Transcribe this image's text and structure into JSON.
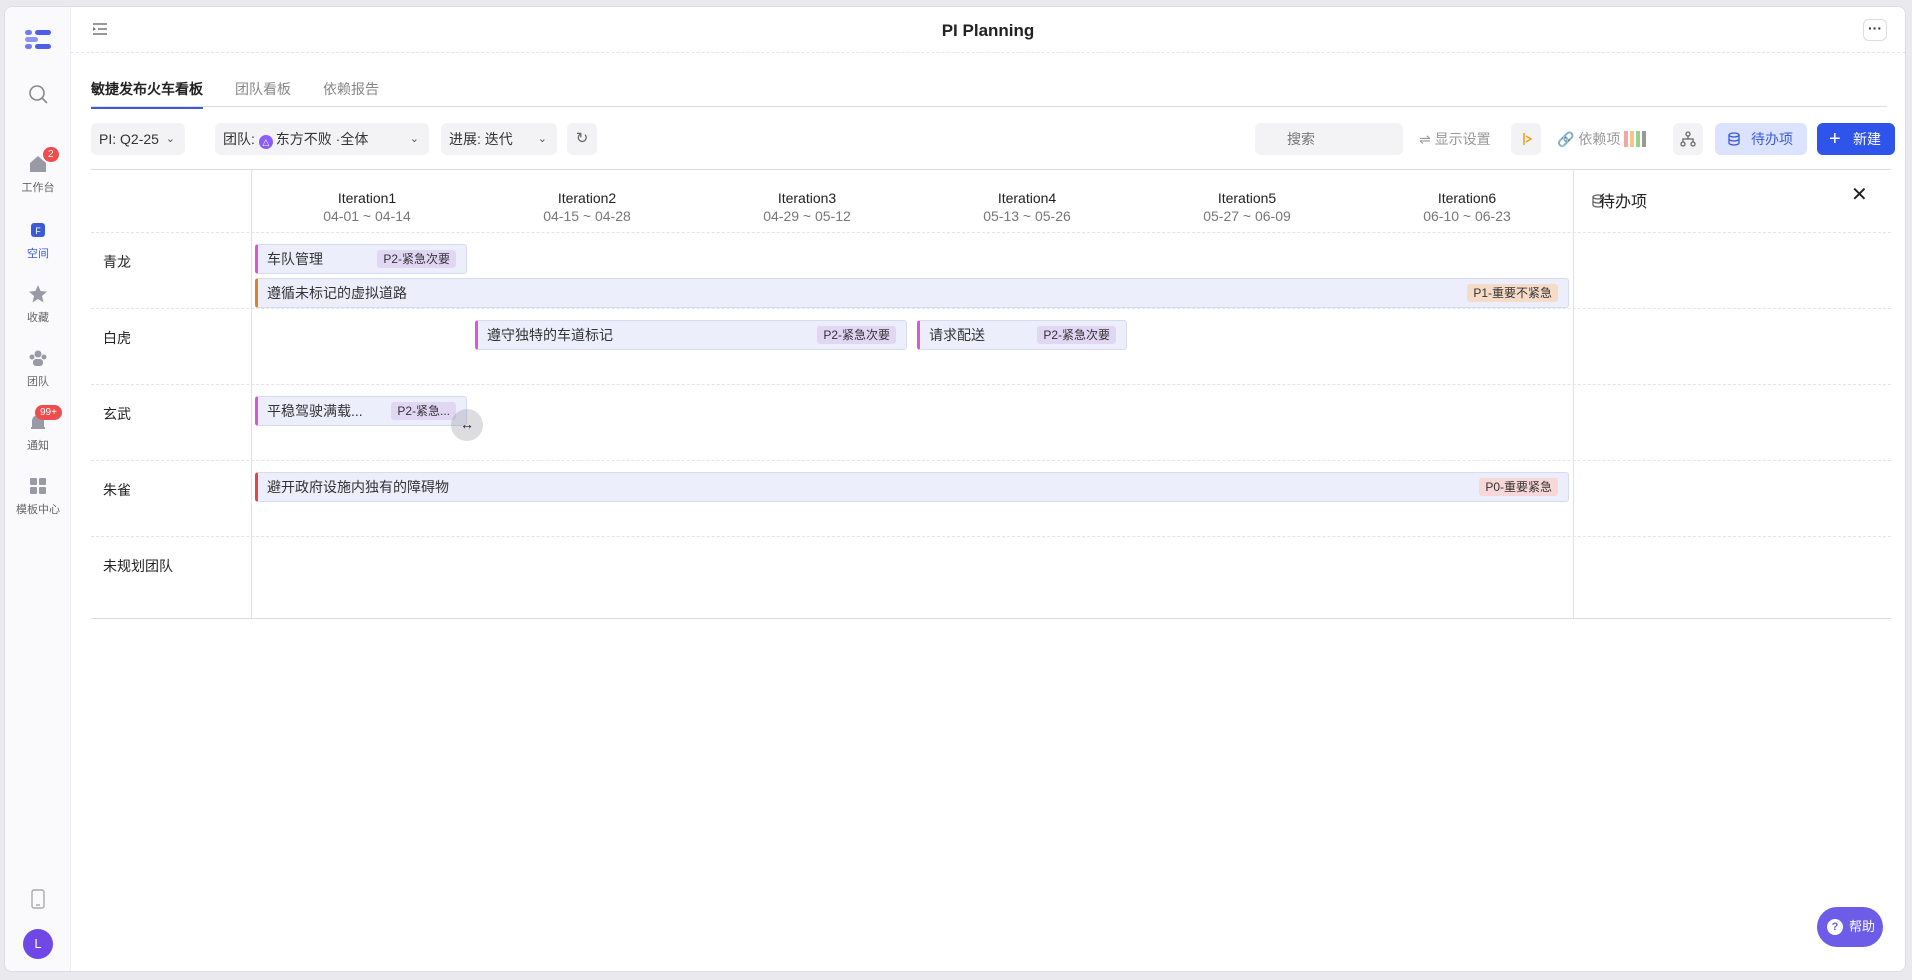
{
  "app": {
    "title": "PI Planning"
  },
  "sidebar": {
    "items": [
      {
        "label": "工作台",
        "icon": "home-icon",
        "badge": "2"
      },
      {
        "label": "空间",
        "icon": "space-icon",
        "active": true
      },
      {
        "label": "收藏",
        "icon": "star-icon"
      },
      {
        "label": "团队",
        "icon": "team-icon"
      },
      {
        "label": "通知",
        "icon": "bell-icon",
        "badge": "99+"
      },
      {
        "label": "模板中心",
        "icon": "template-icon"
      }
    ],
    "avatar": "L"
  },
  "tabs": [
    {
      "label": "敏捷发布火车看板",
      "active": true
    },
    {
      "label": "团队看板"
    },
    {
      "label": "依赖报告"
    }
  ],
  "toolbar": {
    "pi_label": "PI:",
    "pi_value": "Q2-25",
    "team_label": "团队:",
    "team_value": "东方不败 ·全体",
    "progress_label": "进展:",
    "progress_value": "迭代",
    "search_placeholder": "搜索",
    "display_settings": "显示设置",
    "dependency": "依赖项",
    "todo": "待办项",
    "new": "新建"
  },
  "iterations": [
    {
      "name": "Iteration1",
      "dates": "04-01 ~ 04-14"
    },
    {
      "name": "Iteration2",
      "dates": "04-15 ~ 04-28"
    },
    {
      "name": "Iteration3",
      "dates": "04-29 ~ 05-12"
    },
    {
      "name": "Iteration4",
      "dates": "05-13 ~ 05-26"
    },
    {
      "name": "Iteration5",
      "dates": "05-27 ~ 06-09"
    },
    {
      "name": "Iteration6",
      "dates": "06-10 ~ 06-23"
    }
  ],
  "teams": [
    {
      "name": "青龙"
    },
    {
      "name": "白虎"
    },
    {
      "name": "玄武"
    },
    {
      "name": "朱雀"
    },
    {
      "name": "未规划团队"
    }
  ],
  "cards": [
    {
      "title": "车队管理",
      "priority": "P2-紧急次要",
      "color": "#d35bd3"
    },
    {
      "title": "遵循未标记的虚拟道路",
      "priority": "P1-重要不紧急",
      "color": "#d9822b"
    },
    {
      "title": "遵守独特的车道标记",
      "priority": "P2-紧急次要",
      "color": "#d35bd3"
    },
    {
      "title": "请求配送",
      "priority": "P2-紧急次要",
      "color": "#d35bd3"
    },
    {
      "title": "平稳驾驶满载...",
      "priority": "P2-紧急...",
      "color": "#d35bd3"
    },
    {
      "title": "避开政府设施内独有的障碍物",
      "priority": "P0-重要紧急",
      "color": "#e04848"
    }
  ],
  "panel": {
    "title": "待办项"
  },
  "help": {
    "label": "帮助"
  }
}
